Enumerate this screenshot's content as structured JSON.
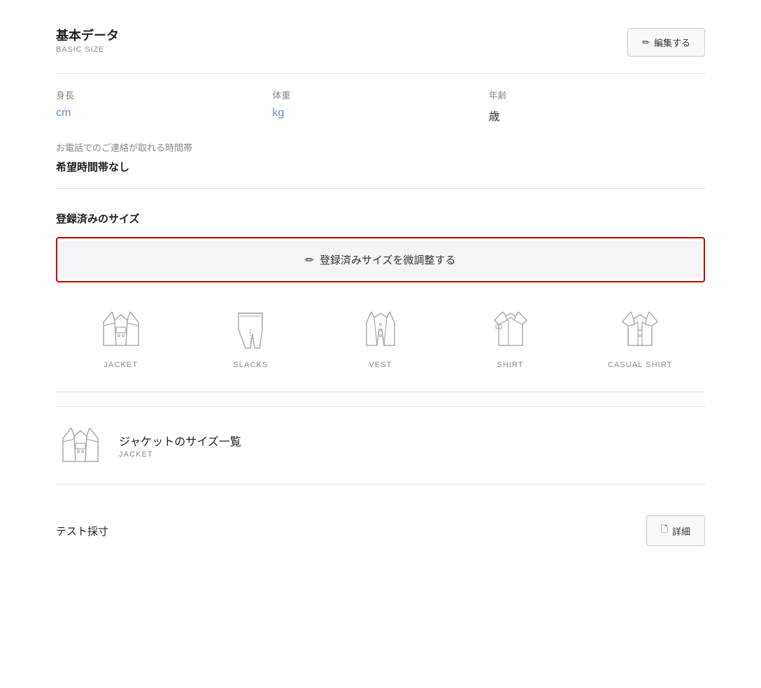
{
  "basic_section": {
    "title_jp": "基本データ",
    "title_en": "BASIC SIZE",
    "edit_button_label": "編集する"
  },
  "fields": {
    "height_label": "身長",
    "height_value": "cm",
    "weight_label": "体重",
    "weight_value": "kg",
    "age_label": "年齢",
    "age_value": "歳"
  },
  "phone_time": {
    "label": "お電話でのご連絡が取れる時間帯",
    "value": "希望時間帯なし"
  },
  "registered_section": {
    "title": "登録済みのサイズ",
    "adjust_button_label": "登録済みサイズを微調整する"
  },
  "clothing_items": [
    {
      "label": "JACKET"
    },
    {
      "label": "SLACKS"
    },
    {
      "label": "VEST"
    },
    {
      "label": "SHIRT"
    },
    {
      "label": "CASUAL\nSHIRT"
    }
  ],
  "jacket_list": {
    "title_jp": "ジャケットのサイズ一覧",
    "title_en": "JACKET"
  },
  "bottom": {
    "label": "テスト採寸",
    "detail_button_label": "詳細"
  },
  "icons": {
    "pencil": "✏",
    "document": "🗋"
  }
}
